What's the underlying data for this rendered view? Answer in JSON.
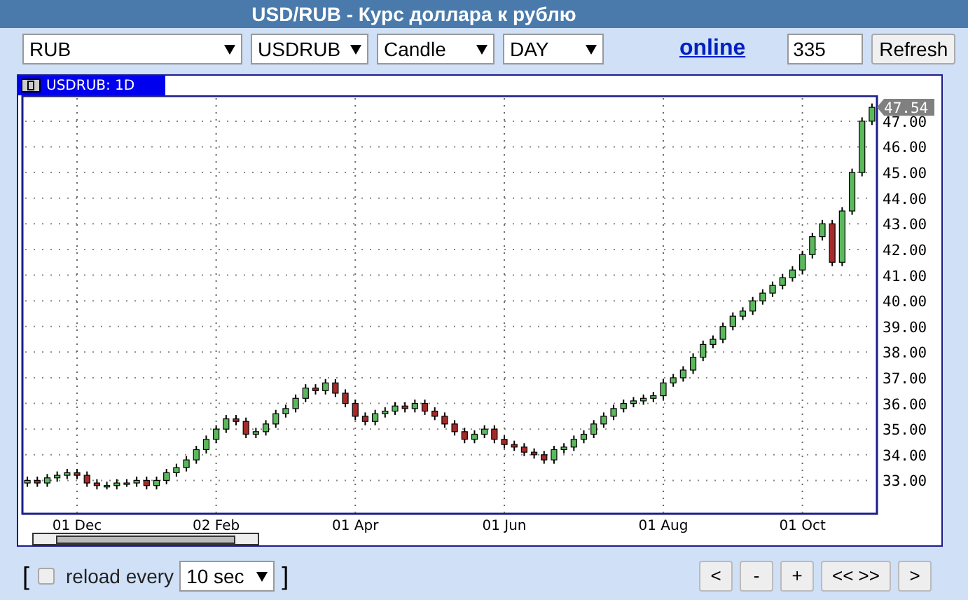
{
  "title": "USD/RUB - Курс доллара к рублю",
  "toolbar": {
    "selects": [
      {
        "value": "RUB"
      },
      {
        "value": "USDRUB"
      },
      {
        "value": "Candle"
      },
      {
        "value": "DAY"
      }
    ],
    "link": "online",
    "count_field": {
      "value": "335"
    },
    "refresh_button": "Refresh"
  },
  "chart_panel": {
    "tab": "USDRUB: 1D",
    "price_tag": "47.54",
    "chart_data": {
      "type": "candlestick",
      "grid": true,
      "ylim": [
        31.7,
        47.98
      ],
      "categories": [
        null,
        null,
        null,
        null,
        null,
        "01 Dec",
        null,
        null,
        null,
        null,
        null,
        null,
        null,
        null,
        null,
        null,
        null,
        null,
        null,
        "02 Feb",
        null,
        null,
        null,
        null,
        null,
        null,
        null,
        null,
        null,
        null,
        null,
        null,
        null,
        "01 Apr",
        null,
        null,
        null,
        null,
        null,
        null,
        null,
        null,
        null,
        null,
        null,
        null,
        null,
        null,
        "01 Jun",
        null,
        null,
        null,
        null,
        null,
        null,
        null,
        null,
        null,
        null,
        null,
        null,
        null,
        null,
        null,
        "01 Aug",
        null,
        null,
        null,
        null,
        null,
        null,
        null,
        null,
        null,
        null,
        null,
        null,
        null,
        "01 Oct",
        null,
        null,
        null,
        null,
        null,
        null,
        null
      ],
      "ohlc": [
        [
          32.9,
          33.15,
          32.75,
          33.0
        ],
        [
          33.0,
          33.15,
          32.75,
          32.9
        ],
        [
          32.9,
          33.25,
          32.75,
          33.1
        ],
        [
          33.1,
          33.35,
          32.95,
          33.2
        ],
        [
          33.2,
          33.45,
          33.05,
          33.3
        ],
        [
          33.3,
          33.45,
          33.05,
          33.2
        ],
        [
          33.2,
          33.35,
          32.75,
          32.9
        ],
        [
          32.9,
          33.05,
          32.65,
          32.8
        ],
        [
          32.8,
          32.95,
          32.65,
          32.8
        ],
        [
          32.8,
          33.05,
          32.65,
          32.9
        ],
        [
          32.9,
          33.05,
          32.75,
          32.9
        ],
        [
          32.9,
          33.15,
          32.75,
          33.0
        ],
        [
          33.0,
          33.15,
          32.65,
          32.8
        ],
        [
          32.8,
          33.15,
          32.65,
          33.0
        ],
        [
          33.0,
          33.45,
          32.85,
          33.3
        ],
        [
          33.3,
          33.65,
          33.15,
          33.5
        ],
        [
          33.5,
          33.95,
          33.35,
          33.8
        ],
        [
          33.8,
          34.35,
          33.65,
          34.2
        ],
        [
          34.2,
          34.75,
          34.05,
          34.6
        ],
        [
          34.6,
          35.15,
          34.45,
          35.0
        ],
        [
          35.0,
          35.55,
          34.85,
          35.4
        ],
        [
          35.4,
          35.55,
          35.15,
          35.3
        ],
        [
          35.3,
          35.45,
          34.65,
          34.8
        ],
        [
          34.8,
          35.05,
          34.65,
          34.9
        ],
        [
          34.9,
          35.35,
          34.75,
          35.2
        ],
        [
          35.2,
          35.75,
          35.05,
          35.6
        ],
        [
          35.6,
          35.95,
          35.45,
          35.8
        ],
        [
          35.8,
          36.35,
          35.65,
          36.2
        ],
        [
          36.2,
          36.75,
          36.05,
          36.6
        ],
        [
          36.6,
          36.75,
          36.35,
          36.5
        ],
        [
          36.5,
          36.95,
          36.35,
          36.8
        ],
        [
          36.8,
          36.95,
          36.25,
          36.4
        ],
        [
          36.4,
          36.55,
          35.85,
          36.0
        ],
        [
          36.0,
          36.15,
          35.35,
          35.5
        ],
        [
          35.5,
          35.65,
          35.15,
          35.3
        ],
        [
          35.3,
          35.75,
          35.15,
          35.6
        ],
        [
          35.6,
          35.85,
          35.45,
          35.7
        ],
        [
          35.7,
          36.05,
          35.55,
          35.9
        ],
        [
          35.9,
          36.05,
          35.65,
          35.8
        ],
        [
          35.8,
          36.15,
          35.65,
          36.0
        ],
        [
          36.0,
          36.15,
          35.55,
          35.7
        ],
        [
          35.7,
          35.85,
          35.35,
          35.5
        ],
        [
          35.5,
          35.65,
          35.05,
          35.2
        ],
        [
          35.2,
          35.35,
          34.75,
          34.9
        ],
        [
          34.9,
          35.05,
          34.45,
          34.6
        ],
        [
          34.6,
          34.95,
          34.45,
          34.8
        ],
        [
          34.8,
          35.15,
          34.65,
          35.0
        ],
        [
          35.0,
          35.15,
          34.45,
          34.6
        ],
        [
          34.6,
          34.75,
          34.25,
          34.4
        ],
        [
          34.4,
          34.55,
          34.15,
          34.3
        ],
        [
          34.3,
          34.45,
          33.95,
          34.1
        ],
        [
          34.1,
          34.25,
          33.85,
          34.0
        ],
        [
          34.0,
          34.15,
          33.65,
          33.8
        ],
        [
          33.8,
          34.35,
          33.65,
          34.2
        ],
        [
          34.2,
          34.45,
          34.05,
          34.3
        ],
        [
          34.3,
          34.75,
          34.15,
          34.6
        ],
        [
          34.6,
          34.95,
          34.45,
          34.8
        ],
        [
          34.8,
          35.35,
          34.65,
          35.2
        ],
        [
          35.2,
          35.65,
          35.05,
          35.5
        ],
        [
          35.5,
          35.95,
          35.35,
          35.8
        ],
        [
          35.8,
          36.15,
          35.65,
          36.0
        ],
        [
          36.0,
          36.25,
          35.85,
          36.1
        ],
        [
          36.1,
          36.35,
          35.95,
          36.2
        ],
        [
          36.2,
          36.45,
          36.05,
          36.3
        ],
        [
          36.3,
          36.95,
          36.15,
          36.8
        ],
        [
          36.8,
          37.15,
          36.65,
          37.0
        ],
        [
          37.0,
          37.45,
          36.85,
          37.3
        ],
        [
          37.3,
          37.95,
          37.15,
          37.8
        ],
        [
          37.8,
          38.45,
          37.65,
          38.3
        ],
        [
          38.3,
          38.65,
          38.15,
          38.5
        ],
        [
          38.5,
          39.15,
          38.35,
          39.0
        ],
        [
          39.0,
          39.55,
          38.85,
          39.4
        ],
        [
          39.4,
          39.75,
          39.25,
          39.6
        ],
        [
          39.6,
          40.15,
          39.45,
          40.0
        ],
        [
          40.0,
          40.45,
          39.85,
          40.3
        ],
        [
          40.3,
          40.75,
          40.15,
          40.6
        ],
        [
          40.6,
          41.05,
          40.45,
          40.9
        ],
        [
          40.9,
          41.35,
          40.75,
          41.2
        ],
        [
          41.2,
          41.95,
          41.05,
          41.8
        ],
        [
          41.8,
          42.65,
          41.65,
          42.5
        ],
        [
          42.5,
          43.15,
          42.35,
          43.0
        ],
        [
          43.0,
          43.15,
          41.35,
          41.5
        ],
        [
          41.5,
          43.65,
          41.35,
          43.5
        ],
        [
          43.5,
          45.15,
          43.35,
          45.0
        ],
        [
          45.0,
          47.15,
          44.85,
          47.0
        ],
        [
          47.0,
          47.69,
          46.85,
          47.54
        ]
      ],
      "yticks": [
        {
          "value": 33,
          "label": "33.00"
        },
        {
          "value": 34,
          "label": "34.00"
        },
        {
          "value": 35,
          "label": "35.00"
        },
        {
          "value": 36,
          "label": "36.00"
        },
        {
          "value": 37,
          "label": "37.00"
        },
        {
          "value": 38,
          "label": "38.00"
        },
        {
          "value": 39,
          "label": "39.00"
        },
        {
          "value": 40,
          "label": "40.00"
        },
        {
          "value": 41,
          "label": "41.00"
        },
        {
          "value": 42,
          "label": "42.00"
        },
        {
          "value": 43,
          "label": "43.00"
        },
        {
          "value": 44,
          "label": "44.00"
        },
        {
          "value": 45,
          "label": "45.00"
        },
        {
          "value": 46,
          "label": "46.00"
        },
        {
          "value": 47,
          "label": "47.00"
        }
      ]
    }
  },
  "footer": {
    "open_bracket": "[",
    "reload": {
      "checked": false,
      "label": "reload every",
      "interval": "10 sec"
    },
    "close_bracket": "]",
    "nav_buttons": [
      "<",
      "-",
      "+",
      "<< >>",
      ">"
    ]
  }
}
